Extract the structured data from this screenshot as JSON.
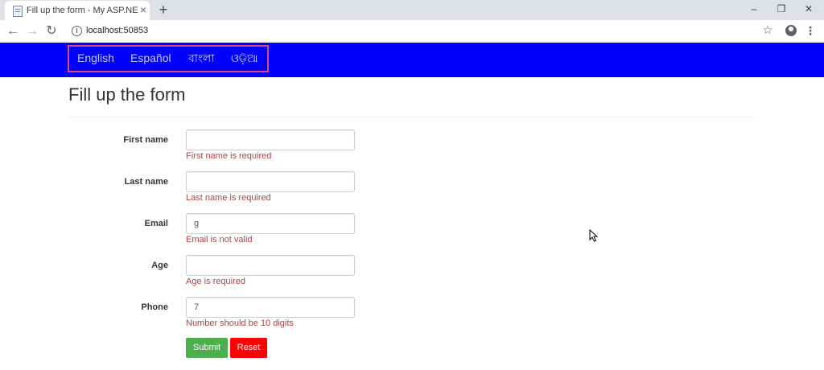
{
  "browser": {
    "tab_title": "Fill up the form - My ASP.NET Ap",
    "tab_close": "×",
    "new_tab": "+",
    "url": "localhost:50853",
    "window_minimize": "–",
    "window_restore": "❐",
    "window_close": "✕"
  },
  "nav": {
    "languages": [
      "English",
      "Español",
      "বাংলা",
      "ଓଡ଼ିଆ"
    ],
    "background": "#0000ff",
    "highlight_border": "#e0457b"
  },
  "page": {
    "title": "Fill up the form"
  },
  "form": {
    "fields": [
      {
        "label": "First name",
        "value": "",
        "error": "First name is required"
      },
      {
        "label": "Last name",
        "value": "",
        "error": "Last name is required"
      },
      {
        "label": "Email",
        "value": "g",
        "error": "Email is not valid"
      },
      {
        "label": "Age",
        "value": "",
        "error": "Age is required"
      },
      {
        "label": "Phone",
        "value": "7",
        "error": "Number should be 10 digits"
      }
    ],
    "submit_label": "Submit",
    "reset_label": "Reset",
    "error_color": "#a94442",
    "submit_color": "#4cae4c",
    "reset_color": "#ff0000"
  }
}
